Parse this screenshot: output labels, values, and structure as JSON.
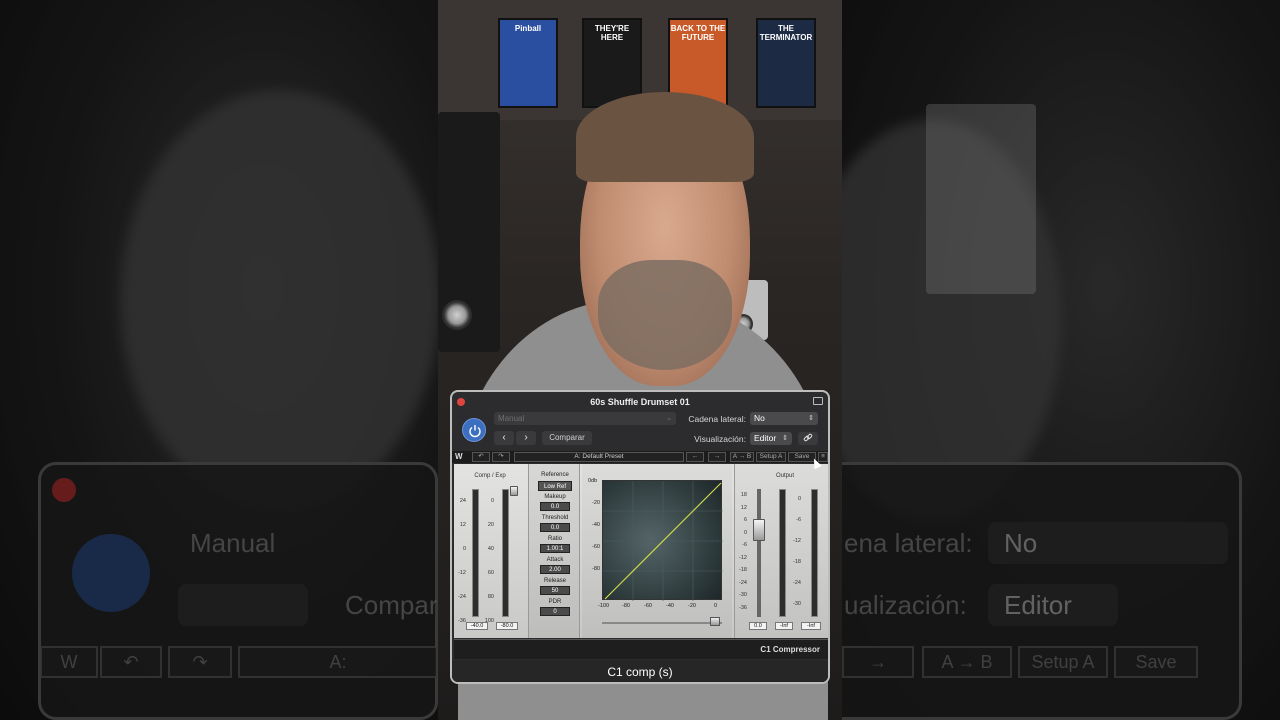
{
  "window": {
    "title": "60s Shuffle Drumset 01",
    "footer_title": "C1 comp (s)"
  },
  "header": {
    "preset_placeholder": "Manual",
    "compare_label": "Comparar",
    "sidechain_label": "Cadena lateral:",
    "sidechain_value": "No",
    "view_label": "Visualización:",
    "view_value": "Editor",
    "prev_glyph": "‹",
    "next_glyph": "›",
    "link_glyph": "🔗"
  },
  "toolbar": {
    "undo": "↶",
    "redo": "↷",
    "preset_name": "A: Default Preset",
    "prev": "←",
    "next": "→",
    "ab": "A → B",
    "setup": "Setup A",
    "save": "Save",
    "menu": "≡"
  },
  "plugin": {
    "brand": "C1 Compressor",
    "comp_exp_label": "Comp / Exp",
    "output_label": "Output",
    "reference_label": "Reference",
    "reference_value": "Low Ref",
    "params": [
      {
        "label": "Makeup",
        "value": "0.0"
      },
      {
        "label": "Threshold",
        "value": "0.0"
      },
      {
        "label": "Ratio",
        "value": "1.00:1"
      },
      {
        "label": "Attack",
        "value": "2.00"
      },
      {
        "label": "Release",
        "value": "50"
      },
      {
        "label": "PDR",
        "value": "0"
      }
    ],
    "left_scale_a": [
      "24",
      "12",
      "0",
      "-12",
      "-24",
      "-36"
    ],
    "left_scale_b": [
      "0",
      "20",
      "40",
      "60",
      "80",
      "100"
    ],
    "left_readout_a": "-40.0",
    "left_readout_b": "-80.0",
    "graph_y": [
      "0db",
      "-20",
      "-40",
      "-60",
      "-80"
    ],
    "graph_x": [
      "-100",
      "-80",
      "-60",
      "-40",
      "-20",
      "0"
    ],
    "out_scale_a": [
      "18",
      "12",
      "6",
      "0",
      "-6",
      "-12",
      "-18",
      "-24",
      "-30",
      "-36"
    ],
    "out_scale_b": [
      "0",
      "-6",
      "-12",
      "-18",
      "-24",
      "-30"
    ],
    "out_readouts": [
      "0.0",
      "-Inf",
      "-Inf"
    ]
  },
  "posters": [
    {
      "title": "Pinball",
      "color": "#2a4fa0"
    },
    {
      "title": "THEY'RE HERE",
      "color": "#1a1a1a"
    },
    {
      "title": "BACK TO THE FUTURE",
      "color": "#c85a2a"
    },
    {
      "title": "THE TERMINATOR",
      "color": "#1c2a44"
    }
  ],
  "background": {
    "power_label": "⏻",
    "sidechain_text": "ena lateral:",
    "sidechain_value": "No",
    "compare_text": "Compar",
    "view_text": "ualización:",
    "view_value": "Editor",
    "preset_text": "Manual",
    "strip_a": "A:",
    "strip_arrow": "→",
    "strip_ab": "A → B",
    "strip_setup": "Setup A",
    "strip_save": "Save"
  }
}
